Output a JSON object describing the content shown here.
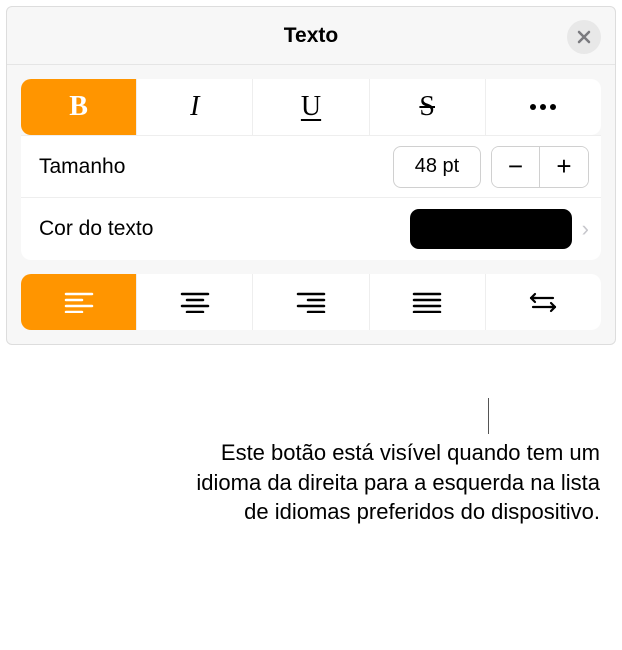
{
  "header": {
    "title": "Texto"
  },
  "style_buttons": {
    "bold_glyph": "B",
    "italic_glyph": "I",
    "underline_glyph": "U",
    "strike_glyph": "S"
  },
  "size_row": {
    "label": "Tamanho",
    "value": "48 pt",
    "minus": "−",
    "plus": "+"
  },
  "color_row": {
    "label": "Cor do texto",
    "color": "#000000"
  },
  "caption": "Este botão está visível quando tem um idioma da direita para a esquerda na lista de idiomas preferidos do dispositivo."
}
